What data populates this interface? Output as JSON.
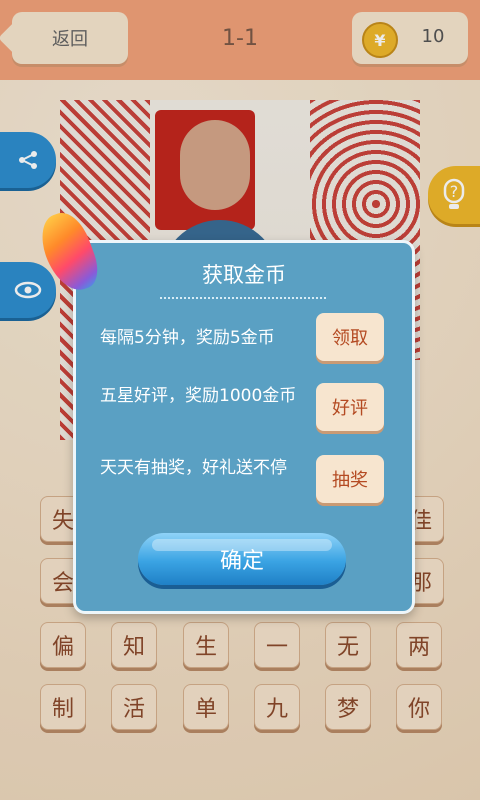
{
  "header": {
    "back_label": "返回",
    "level": "1-1",
    "coin_symbol": "¥",
    "coins": "10"
  },
  "side": {
    "share_icon": "share-icon",
    "eye_icon": "eye-icon",
    "help_icon": "help-icon"
  },
  "tiles": {
    "row1": [
      "失",
      "佳"
    ],
    "row2": [
      "会",
      "那"
    ],
    "row3": [
      "偏",
      "知",
      "生",
      "一",
      "无",
      "两"
    ],
    "row4": [
      "制",
      "活",
      "单",
      "九",
      "梦",
      "你"
    ]
  },
  "dialog": {
    "title": "获取金币",
    "rows": [
      {
        "text": "每隔5分钟，奖励5金币",
        "button": "领取"
      },
      {
        "text": "五星好评，奖励1000金币",
        "button": "好评"
      },
      {
        "text": "天天有抽奖，好礼送不停",
        "button": "抽奖"
      }
    ],
    "confirm": "确定"
  },
  "colors": {
    "topbar": "#f2a27a",
    "dialog_bg": "#5aa0c3",
    "accent_blue": "#2e8fd0",
    "coin_gold": "#f0b92c"
  }
}
